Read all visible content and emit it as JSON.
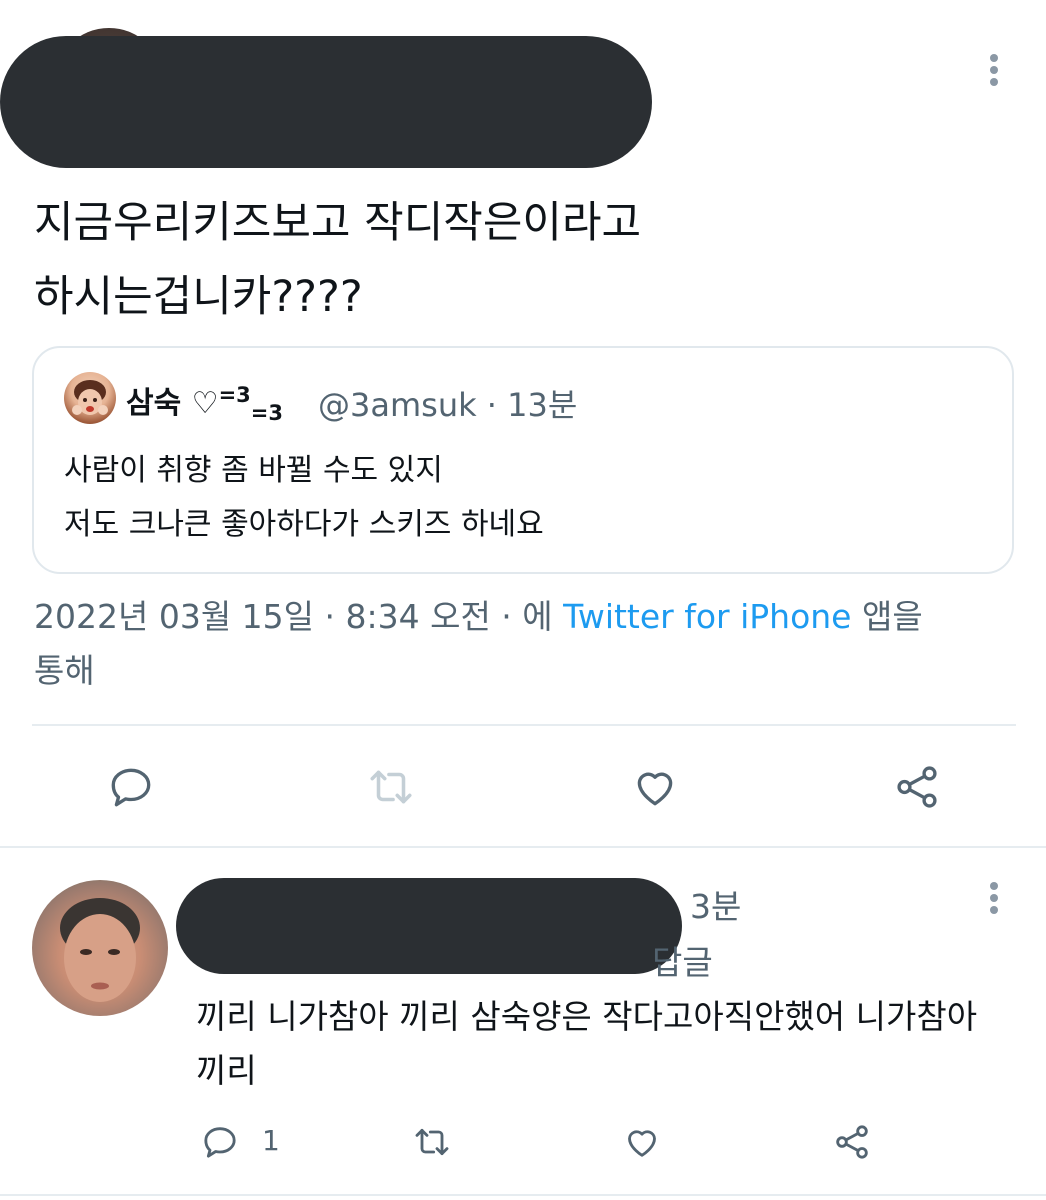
{
  "tweet": {
    "text_line1": "지금우리키즈보고 작디작은이라고",
    "text_line2": "하시는겁니카????",
    "quote": {
      "name": "삼숙",
      "name_emoji_heart": "♡",
      "name_sup": "=3",
      "name_sub": "=3",
      "handle_time": "@3amsuk · 13분",
      "line1": "사람이 취향 좀 바뀔 수도 있지",
      "line2": "저도 크나큰 좋아하다가 스키즈 하네요"
    },
    "meta": {
      "date_time": "2022년 03월 15일 · 8:34 오전 · 에",
      "source": "Twitter for iPhone",
      "suffix_line1": "앱을",
      "suffix_line2": "통해"
    }
  },
  "reply": {
    "time": "3분",
    "reply_label": "답글",
    "text_line1": "끼리 니가참아 끼리 삼숙양은 작다고아직안했어 니가참아",
    "text_line2": "끼리",
    "reply_count": "1"
  },
  "colors": {
    "link": "#1d9bf0",
    "secondary": "#536471",
    "icon": "#536471",
    "retweet_disabled": "#c4cfd6",
    "divider": "#e6ecf0"
  }
}
